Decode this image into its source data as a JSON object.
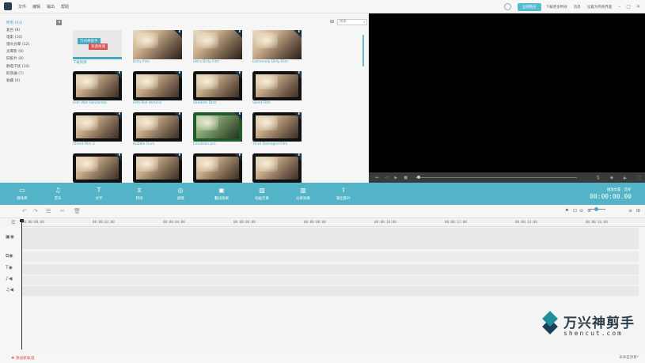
{
  "menu": {
    "items": [
      "文件",
      "编辑",
      "输出",
      "帮助"
    ]
  },
  "header": {
    "purchase": "立即购买",
    "download": "下载更多特效",
    "message": "消息",
    "switch_mode": "设置为简易界面"
  },
  "window": {
    "minimize": "–",
    "restore": "▢",
    "close": "✕"
  },
  "sidebar": {
    "collapse": "◂",
    "items": [
      {
        "label": "所有 (63)",
        "active": true
      },
      {
        "label": "复古 (8)"
      },
      {
        "label": "电影 (10)"
      },
      {
        "label": "镜头光晕 (12)"
      },
      {
        "label": "光晕影 (9)"
      },
      {
        "label": "旧胶片 (8)"
      },
      {
        "label": "静电干扰 (10)"
      },
      {
        "label": "取景器 (7)"
      },
      {
        "label": "收藏 (0)"
      }
    ]
  },
  "library": {
    "search_placeholder": "搜索",
    "tiles": [
      {
        "label": "下载资源",
        "style": "promo",
        "promo1": "万兴神剪手",
        "promo2": "资源商城"
      },
      {
        "label": "Dirty Film",
        "style": "plain"
      },
      {
        "label": "Ultra Dirty Film",
        "style": "plain"
      },
      {
        "label": "Extremely Dirty Film",
        "style": "plain"
      },
      {
        "label": "Film Wet Horizontal",
        "style": "frame"
      },
      {
        "label": "Film Roll Vertical",
        "style": "frame"
      },
      {
        "label": "Random Dots",
        "style": "frame"
      },
      {
        "label": "Silent Film",
        "style": "frame"
      },
      {
        "label": "Street Film 2",
        "style": "frame"
      },
      {
        "label": "Bubble Gum",
        "style": "frame"
      },
      {
        "label": "Emulsion pro",
        "style": "green"
      },
      {
        "label": "Third Damaged Film",
        "style": "frame"
      },
      {
        "label": "",
        "style": "frame"
      },
      {
        "label": "",
        "style": "frame"
      },
      {
        "label": "",
        "style": "frame"
      },
      {
        "label": "",
        "style": "frame"
      }
    ]
  },
  "toolbar": {
    "items": [
      {
        "label": "媒体库",
        "icon": "folder-icon",
        "glyph": "▭"
      },
      {
        "label": "音乐",
        "icon": "music-icon",
        "glyph": "♫"
      },
      {
        "label": "文字",
        "icon": "text-icon",
        "glyph": "T"
      },
      {
        "label": "转场",
        "icon": "transition-icon",
        "glyph": "⧖"
      },
      {
        "label": "滤镜",
        "icon": "filter-icon",
        "glyph": "◎"
      },
      {
        "label": "叠加效果",
        "icon": "overlay-icon",
        "glyph": "▣"
      },
      {
        "label": "动画元素",
        "icon": "element-icon",
        "glyph": "▨"
      },
      {
        "label": "分屏效果",
        "icon": "splitscreen-icon",
        "glyph": "▥"
      },
      {
        "label": "输出影片",
        "icon": "export-icon",
        "glyph": "⇪"
      }
    ],
    "timecode_label": "播放位置  :  选择",
    "timecode": "00:00:00.00"
  },
  "timeline": {
    "ticks": [
      "00:00:00:00",
      "00:00:02:00",
      "00:00:04:00",
      "00:00:06:00",
      "00:00:08:00",
      "00:00:10:00",
      "00:00:12:00",
      "00:00:14:00",
      "00:00:16:00"
    ]
  },
  "footer": {
    "add_track": "添加新轨道",
    "project": "未命名项目*"
  },
  "watermark": {
    "title": "万兴神剪手",
    "url": "shencut.com"
  },
  "colors": {
    "accent": "#52b4c6",
    "preview_bg": "#000000",
    "promo_red": "#d9534f"
  }
}
